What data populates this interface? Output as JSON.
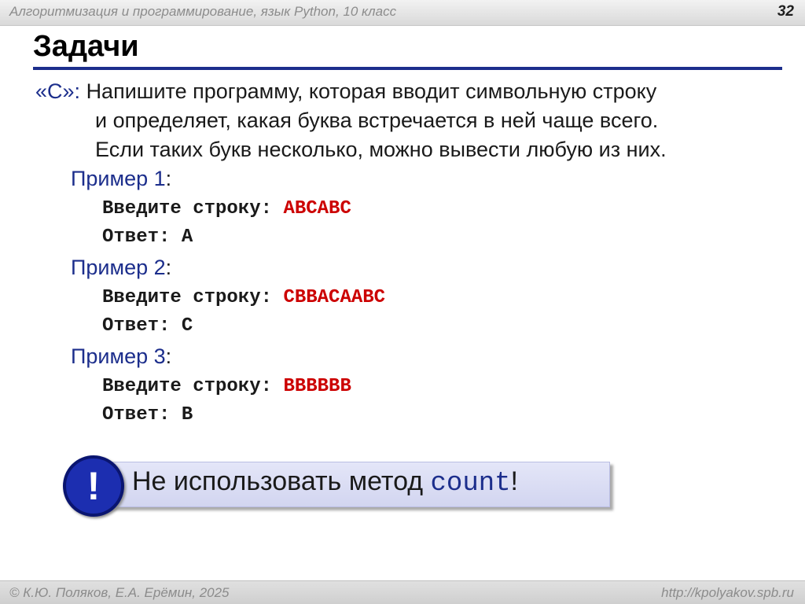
{
  "header": {
    "course": "Алгоритмизация и программирование, язык Python, 10 класс",
    "slide_number": "32"
  },
  "title": "Задачи",
  "task": {
    "level": "«C»:",
    "lines": [
      "Напишите программу, которая вводит символьную строку",
      "и определяет, какая буква встречается в ней чаще всего.",
      "Если таких букв несколько, можно вывести любую из них."
    ]
  },
  "examples": [
    {
      "label": "Пример 1",
      "prompt": "Введите строку: ",
      "input": "ABCABC",
      "answer_label": "Ответ: ",
      "answer": "A"
    },
    {
      "label": "Пример 2",
      "prompt": "Введите строку: ",
      "input": "CBBACAABC",
      "answer_label": "Ответ: ",
      "answer": "C"
    },
    {
      "label": "Пример 3",
      "prompt": "Введите строку: ",
      "input": "BBBBBB",
      "answer_label": "Ответ: ",
      "answer": "B"
    }
  ],
  "note": {
    "icon_glyph": "!",
    "text": "Не использовать метод ",
    "code": "count",
    "end": "!"
  },
  "footer": {
    "authors": "© К.Ю. Поляков, Е.А. Ерёмин, 2025",
    "url": "http://kpolyakov.spb.ru"
  },
  "colors": {
    "accent": "#1c2e8c",
    "input": "#cc0000"
  }
}
